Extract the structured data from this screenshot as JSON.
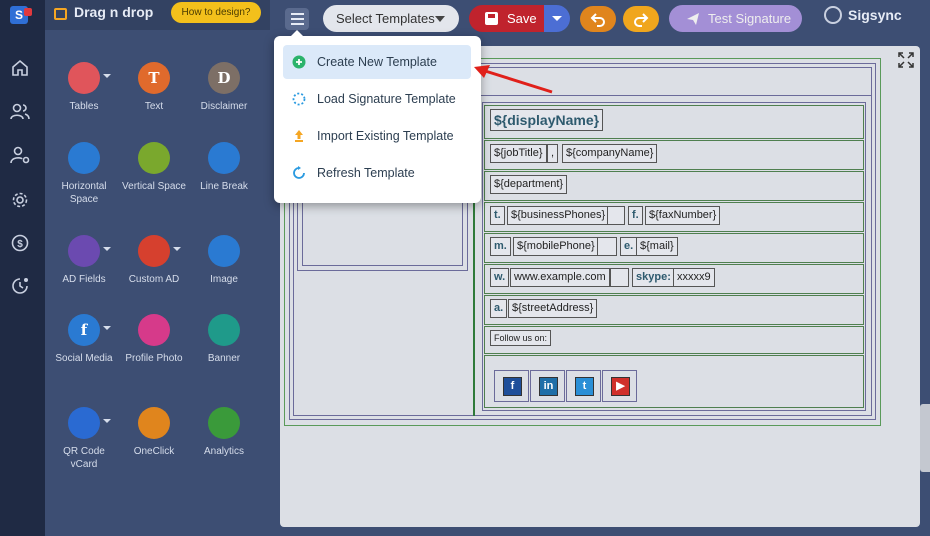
{
  "sidebar": {
    "rail_icons": [
      "logo",
      "home-icon",
      "users-icon",
      "user-settings-icon",
      "gear-icon",
      "dollar-icon",
      "history-icon"
    ],
    "panel_title": "Drag n drop",
    "how_button": "How to design?",
    "tools": [
      {
        "label": "Tables",
        "icon": "table-icon",
        "color": "#e0555b",
        "glyph": "",
        "dropdown": true
      },
      {
        "label": "Text",
        "icon": "text-icon",
        "color": "#e06a2c",
        "glyph": "T",
        "dropdown": false
      },
      {
        "label": "Disclaimer",
        "icon": "disclaimer-icon",
        "color": "#7d6f66",
        "glyph": "D",
        "dropdown": false
      },
      {
        "label": "Horizontal Space",
        "icon": "horizontal-space-icon",
        "color": "#2a7ad2",
        "glyph": "",
        "dropdown": false
      },
      {
        "label": "Vertical Space",
        "icon": "vertical-space-icon",
        "color": "#7aa82d",
        "glyph": "",
        "dropdown": false
      },
      {
        "label": "Line Break",
        "icon": "line-break-icon",
        "color": "#2a7ad2",
        "glyph": "",
        "dropdown": false
      },
      {
        "label": "AD Fields",
        "icon": "ad-fields-icon",
        "color": "#6b4ab0",
        "glyph": "",
        "dropdown": true
      },
      {
        "label": "Custom AD",
        "icon": "custom-ad-icon",
        "color": "#d6402e",
        "glyph": "",
        "dropdown": true
      },
      {
        "label": "Image",
        "icon": "image-icon",
        "color": "#2a7ad2",
        "glyph": "",
        "dropdown": false
      },
      {
        "label": "Social Media",
        "icon": "social-media-icon",
        "color": "#2a7ad2",
        "glyph": "f",
        "dropdown": true
      },
      {
        "label": "Profile Photo",
        "icon": "profile-photo-icon",
        "color": "#d63a8a",
        "glyph": "",
        "dropdown": false
      },
      {
        "label": "Banner",
        "icon": "banner-icon",
        "color": "#1f9a8a",
        "glyph": "",
        "dropdown": false
      },
      {
        "label": "QR Code vCard",
        "icon": "qr-code-icon",
        "color": "#2a6ad2",
        "glyph": "",
        "dropdown": true
      },
      {
        "label": "OneClick",
        "icon": "oneclick-icon",
        "color": "#e0851d",
        "glyph": "",
        "dropdown": false
      },
      {
        "label": "Analytics",
        "icon": "analytics-icon",
        "color": "#3a9a3a",
        "glyph": "",
        "dropdown": false
      }
    ]
  },
  "toolbar": {
    "select_templates": "Select Templates",
    "save": "Save",
    "test_signature": "Test Signature",
    "user_name": "Sigsync"
  },
  "menu": {
    "items": [
      {
        "label": "Create New Template",
        "icon": "plus-circle-icon",
        "color": "#2bb36b"
      },
      {
        "label": "Load Signature Template",
        "icon": "spinner-icon",
        "color": "#2a9ae0"
      },
      {
        "label": "Import Existing Template",
        "icon": "upload-icon",
        "color": "#f5a623"
      },
      {
        "label": "Refresh Template",
        "icon": "refresh-icon",
        "color": "#2a9ae0"
      }
    ]
  },
  "signature": {
    "display_name": "${displayName}",
    "job_title": "${jobTitle}",
    "separator": ",",
    "company_name": "${companyName}",
    "department": "${department}",
    "phone_label": "t.",
    "business_phones": "${businessPhones}",
    "fax_label": "f.",
    "fax_number": "${faxNumber}",
    "mobile_label": "m.",
    "mobile_phone": "${mobilePhone}",
    "email_label": "e.",
    "mail": "${mail}",
    "web_label": "w.",
    "website": "www.example.com",
    "skype_label": "skype:",
    "skype": "xxxxx9",
    "address_label": "a.",
    "street_address": "${streetAddress}",
    "follow_us": "Follow us on:",
    "social": [
      {
        "name": "facebook-icon",
        "glyph": "f",
        "color": "#1f4f9a"
      },
      {
        "name": "linkedin-icon",
        "glyph": "in",
        "color": "#1f6fa8"
      },
      {
        "name": "twitter-icon",
        "glyph": "t",
        "color": "#2a8fd6"
      },
      {
        "name": "youtube-icon",
        "glyph": "▶",
        "color": "#d0302a"
      }
    ]
  }
}
